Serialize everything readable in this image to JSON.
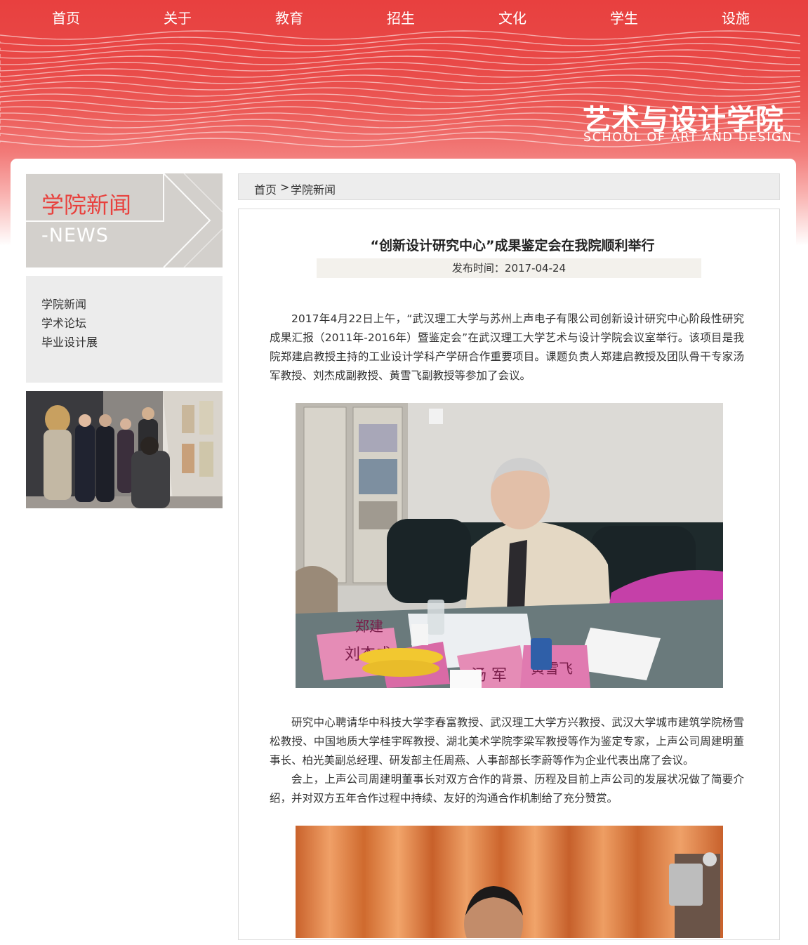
{
  "nav": [
    "首页",
    "关于",
    "教育",
    "招生",
    "文化",
    "学生",
    "设施"
  ],
  "logo": {
    "cn": "艺术与设计学院",
    "en": "SCHOOL OF ART AND DESIGN"
  },
  "sidebar": {
    "title_cn": "学院新闻",
    "title_en": "-NEWS",
    "items": [
      {
        "label": "学院新闻"
      },
      {
        "label": "学术论坛"
      },
      {
        "label": "毕业设计展"
      }
    ]
  },
  "breadcrumb": {
    "home": "首页",
    "sep": ">",
    "current": "学院新闻"
  },
  "article": {
    "title": "“创新设计研究中心”成果鉴定会在我院顺利举行",
    "pubdate": "发布时间：2017-04-24",
    "paragraphs": [
      "2017年4月22日上午，“武汉理工大学与苏州上声电子有限公司创新设计研究中心阶段性研究成果汇报（2011年-2016年）暨鉴定会”在武汉理工大学艺术与设计学院会议室举行。该项目是我院郑建启教授主持的工业设计学科产学研合作重要项目。课题负责人郑建启教授及团队骨干专家汤军教授、刘杰成副教授、黄雪飞副教授等参加了会议。",
      "研究中心聘请华中科技大学李春富教授、武汉理工大学方兴教授、武汉大学城市建筑学院杨雪松教授、中国地质大学桂宇晖教授、湖北美术学院李梁军教授等作为鉴定专家，上声公司周建明董事长、柏光美副总经理、研发部主任周燕、人事部部长李蔚等作为企业代表出席了会议。",
      "会上，上声公司周建明董事长对双方合作的背景、历程及目前上声公司的发展状况做了简要介绍，并对双方五年合作过程中持续、友好的沟通合作机制给了充分赞赏。"
    ],
    "placards": [
      "郑建",
      "刘杰成",
      "汤 军",
      "黄雪飞"
    ]
  }
}
